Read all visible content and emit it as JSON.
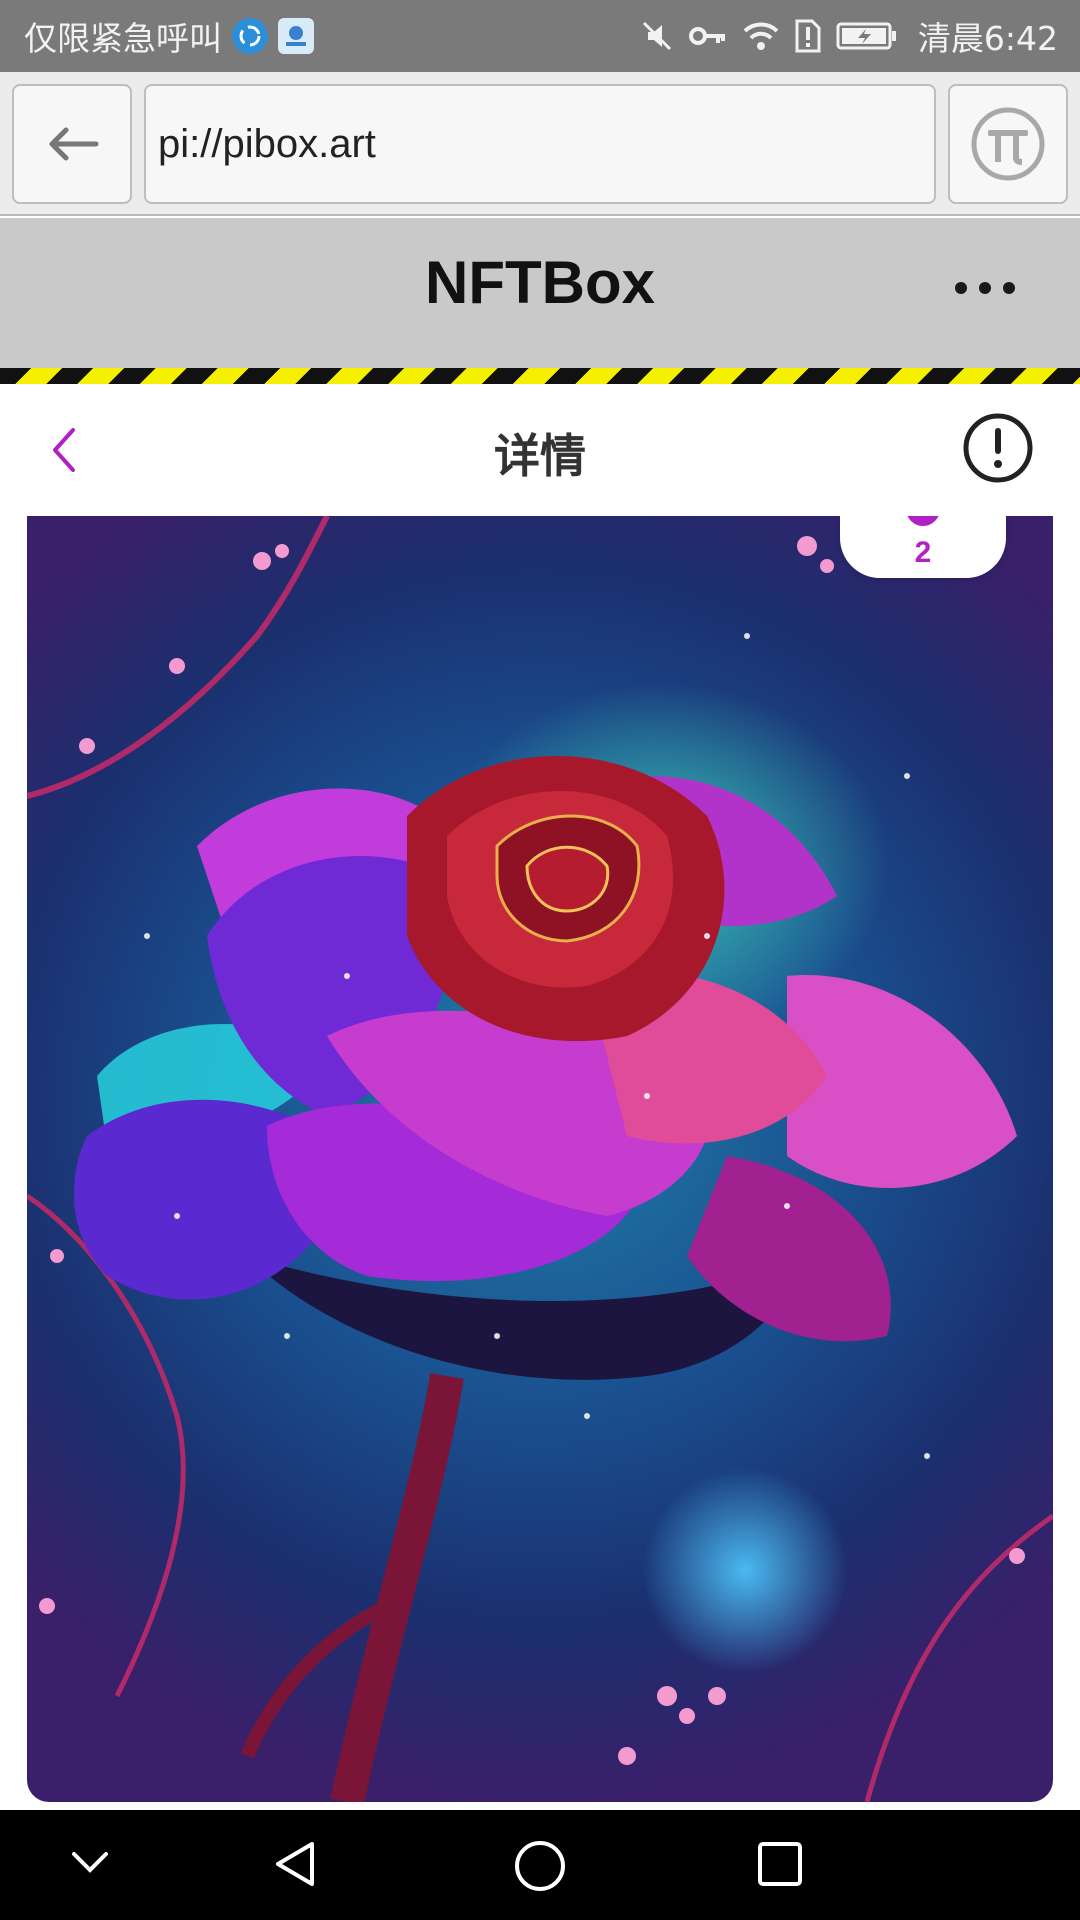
{
  "status_bar": {
    "carrier_text": "仅限紧急呼叫",
    "clock": "清晨6:42",
    "icons": [
      "app-swirl-icon",
      "app-badge-icon",
      "mute-icon",
      "key-icon",
      "wifi-icon",
      "sim-alert-icon",
      "battery-charging-icon"
    ]
  },
  "browser": {
    "url": "pi://pibox.art",
    "back_icon": "arrow-left-icon",
    "menu_icon": "pi-logo-icon"
  },
  "app_header": {
    "title": "NFTBox",
    "more_icon": "more-dots-icon"
  },
  "page_nav": {
    "title": "详情",
    "back_icon": "chevron-left-icon",
    "info_icon": "exclamation-circle-icon",
    "accent": "#b21fc4"
  },
  "artwork": {
    "rank_badge": "2"
  },
  "system_nav": {
    "icons": [
      "chevron-down-icon",
      "back-triangle-icon",
      "home-circle-icon",
      "recents-square-icon"
    ]
  }
}
